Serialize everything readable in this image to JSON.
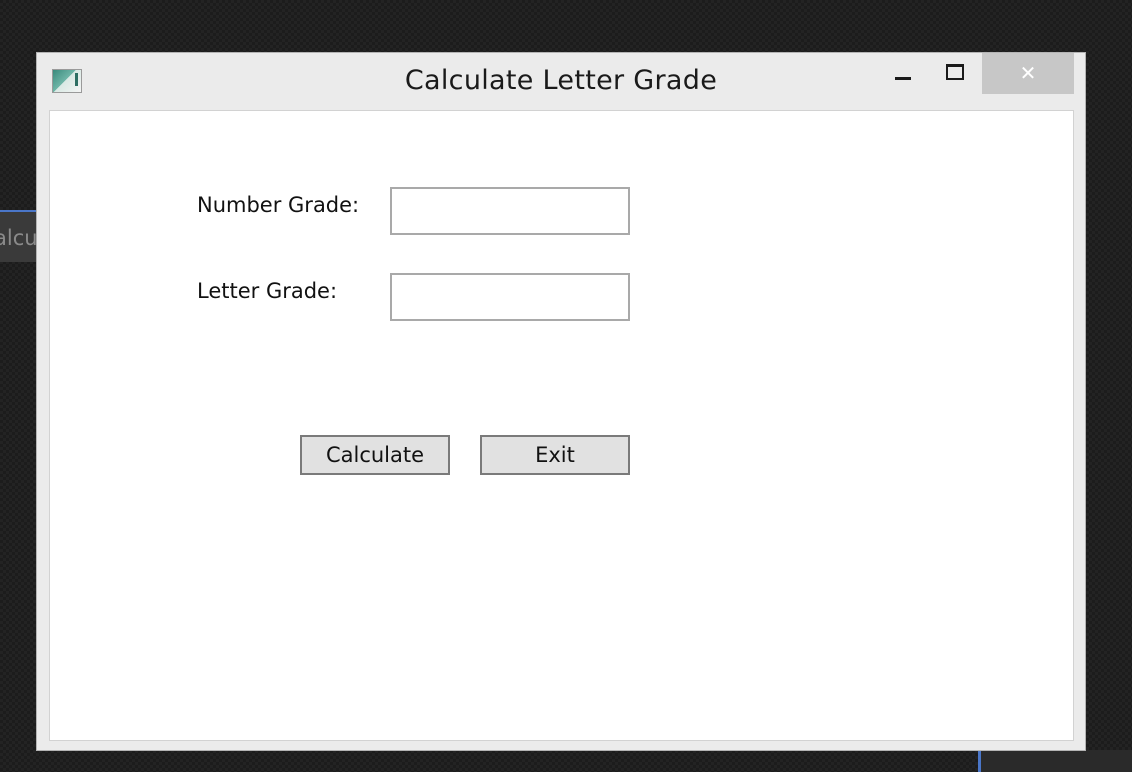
{
  "background": {
    "partial_window_text": "alcu"
  },
  "window": {
    "title": "Calculate Letter Grade",
    "icon": "app-icon",
    "controls": {
      "minimize_icon": "minimize-icon",
      "maximize_icon": "maximize-icon",
      "close_icon": "close-icon",
      "close_glyph": "✕"
    }
  },
  "form": {
    "number_grade": {
      "label": "Number Grade:",
      "value": ""
    },
    "letter_grade": {
      "label": "Letter Grade:",
      "value": ""
    },
    "buttons": {
      "calculate": "Calculate",
      "exit": "Exit"
    }
  },
  "colors": {
    "window_frame": "#ebebeb",
    "client_area": "#ffffff",
    "close_button": "#c7c7c7",
    "button_face": "#e1e1e1",
    "taskbar_accent": "#4a76c8"
  }
}
